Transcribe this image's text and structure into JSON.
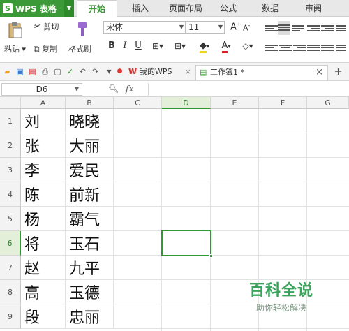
{
  "app": {
    "title": "WPS 表格"
  },
  "menu_tabs": [
    "开始",
    "插入",
    "页面布局",
    "公式",
    "数据",
    "审阅"
  ],
  "ribbon": {
    "paste": "粘贴",
    "cut": "剪切",
    "copy": "复制",
    "format_painter": "格式刷",
    "font_name": "宋体",
    "font_size": "11"
  },
  "doc_tabs": [
    {
      "label": "我的WPS"
    },
    {
      "label": "工作簿1 *"
    }
  ],
  "formula_bar": {
    "name_box": "D6",
    "fx": "fx",
    "value": ""
  },
  "columns": [
    "A",
    "B",
    "C",
    "D",
    "E",
    "F",
    "G"
  ],
  "rows": [
    {
      "num": "1",
      "a": "刘",
      "b": "晓晓"
    },
    {
      "num": "2",
      "a": "张",
      "b": "大丽"
    },
    {
      "num": "3",
      "a": "李",
      "b": "爱民"
    },
    {
      "num": "4",
      "a": "陈",
      "b": "前新"
    },
    {
      "num": "5",
      "a": "杨",
      "b": "霸气"
    },
    {
      "num": "6",
      "a": "将",
      "b": "玉石"
    },
    {
      "num": "7",
      "a": "赵",
      "b": "九平"
    },
    {
      "num": "8",
      "a": "高",
      "b": "玉德"
    },
    {
      "num": "9",
      "a": "段",
      "b": "忠丽"
    }
  ],
  "watermark": {
    "title": "百科全说",
    "subtitle": "助你轻松解决"
  },
  "colors": {
    "brand": "#3b9a37",
    "selected": "#2f9a2f"
  }
}
